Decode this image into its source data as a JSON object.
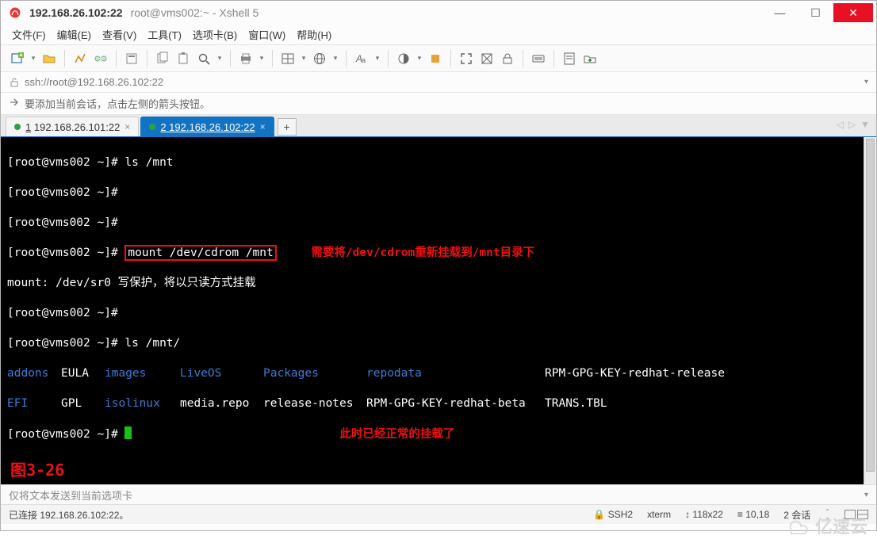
{
  "title": {
    "main": "192.168.26.102:22",
    "sub": "root@vms002:~ - Xshell 5"
  },
  "menu": {
    "file": "文件(F)",
    "edit": "编辑(E)",
    "view": "查看(V)",
    "tools": "工具(T)",
    "tabs": "选项卡(B)",
    "window": "窗口(W)",
    "help": "帮助(H)"
  },
  "address": {
    "url": "ssh://root@192.168.26.102:22"
  },
  "hint": {
    "text": "要添加当前会话，点击左侧的箭头按钮。"
  },
  "tabs": [
    {
      "num": "1",
      "label": "192.168.26.101:22"
    },
    {
      "num": "2",
      "label": "192.168.26.102:22"
    }
  ],
  "terminal": {
    "prompt": "[root@vms002 ~]#",
    "cmd_ls_mnt": "ls /mnt",
    "cmd_mount": "mount /dev/cdrom /mnt",
    "mount_msg": "mount: /dev/sr0 写保护，将以只读方式挂载",
    "cmd_ls_mnt2": "ls /mnt/",
    "note1": "需要将/dev/cdrom重新挂载到/mnt目录下",
    "note2": "此时已经正常的挂载了",
    "row1": {
      "c1": "addons",
      "c2": "EULA",
      "c3": "images",
      "c4": "LiveOS",
      "c5": "Packages",
      "c6": "repodata",
      "c7": "RPM-GPG-KEY-redhat-release"
    },
    "row2": {
      "c1": "EFI",
      "c2": "GPL",
      "c3": "isolinux",
      "c4": "media.repo",
      "c5": "release-notes",
      "c6": "RPM-GPG-KEY-redhat-beta",
      "c7": "TRANS.TBL"
    },
    "fig": "图3-26"
  },
  "sendbar": {
    "placeholder": "仅将文本发送到当前选项卡"
  },
  "status": {
    "conn": "已连接 192.168.26.102:22。",
    "ssh": "SSH2",
    "term": "xterm",
    "size": "118x22",
    "pos": "10,18",
    "sessions": "2 会话"
  },
  "watermark": {
    "text": "亿速云"
  },
  "icons": {
    "min": "—",
    "max": "☐",
    "close": "✕",
    "chev": "▾",
    "tri_l": "◁",
    "tri_r": "▷",
    "tri_d": "▼",
    "plus": "+",
    "x": "×",
    "arrows": "↕",
    "caret_up": "⌃",
    "caret_dn": "⌄",
    "lock_open": "🔓"
  }
}
